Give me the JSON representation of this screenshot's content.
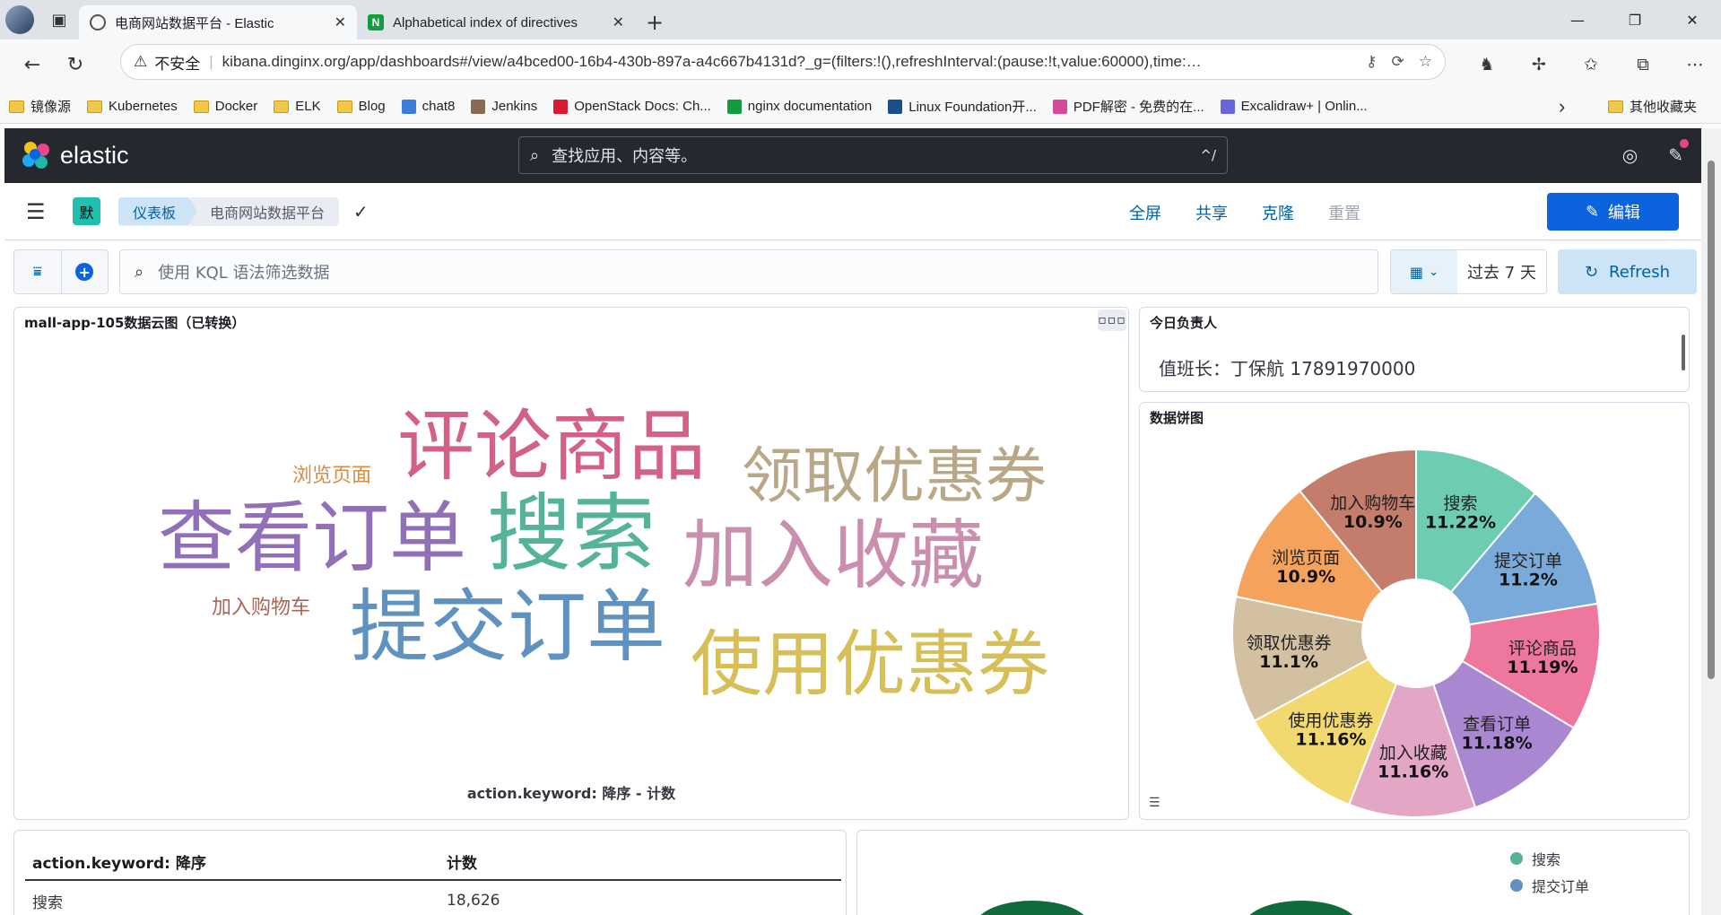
{
  "browser": {
    "tabs": [
      {
        "title": "电商网站数据平台 - Elastic",
        "active": true
      },
      {
        "title": "Alphabetical index of directives",
        "active": false
      }
    ],
    "address": {
      "security_label": "不安全",
      "url": "kibana.dinginx.org/app/dashboards#/view/a4bced00-16b4-430b-897a-a4c667b4131d?_g=(filters:!(),refreshInterval:(pause:!t,value:60000),time:…"
    },
    "bookmarks": [
      {
        "label": "镜像源",
        "icon": "folder-icon"
      },
      {
        "label": "Kubernetes",
        "icon": "folder-icon"
      },
      {
        "label": "Docker",
        "icon": "folder-icon"
      },
      {
        "label": "ELK",
        "icon": "folder-icon"
      },
      {
        "label": "Blog",
        "icon": "folder-icon"
      },
      {
        "label": "chat8",
        "icon": "chat-icon"
      },
      {
        "label": "Jenkins",
        "icon": "jenkins-icon"
      },
      {
        "label": "OpenStack Docs: Ch...",
        "icon": "openstack-icon"
      },
      {
        "label": "nginx documentation",
        "icon": "nginx-icon"
      },
      {
        "label": "Linux Foundation开...",
        "icon": "linux-foundation-icon"
      },
      {
        "label": "PDF解密 - 免费的在...",
        "icon": "pdf-icon"
      },
      {
        "label": "Excalidraw+ | Onlin...",
        "icon": "excalidraw-icon"
      }
    ],
    "other_bookmarks": "其他收藏夹"
  },
  "kibana": {
    "brand": "elastic",
    "search_placeholder": "查找应用、内容等。",
    "search_shortcut": "^/",
    "space_badge": "默",
    "breadcrumbs": [
      "仪表板",
      "电商网站数据平台"
    ],
    "actions": {
      "fullscreen": "全屏",
      "share": "共享",
      "clone": "克隆",
      "reset": "重置",
      "edit": "编辑"
    },
    "query_placeholder": "使用 KQL 语法筛选数据",
    "time_range": "过去 7 天",
    "refresh": "Refresh"
  },
  "panels": {
    "wordcloud": {
      "title": "mall-app-105数据云图（已转换）",
      "footer": "action.keyword: 降序 - 计数",
      "words": [
        {
          "text": "评论商品",
          "color": "#d36086"
        },
        {
          "text": "领取优惠券",
          "color": "#b9a888"
        },
        {
          "text": "浏览页面",
          "color": "#da8b45"
        },
        {
          "text": "查看订单",
          "color": "#9170b8"
        },
        {
          "text": "搜索",
          "color": "#54b399"
        },
        {
          "text": "加入收藏",
          "color": "#ca8eae"
        },
        {
          "text": "加入购物车",
          "color": "#aa6556"
        },
        {
          "text": "提交订单",
          "color": "#6092c0"
        },
        {
          "text": "使用优惠券",
          "color": "#d6bf57"
        }
      ]
    },
    "duty": {
      "title": "今日负责人",
      "text": "值班长：丁保航 17891970000"
    },
    "pie": {
      "title": "数据饼图"
    },
    "table": {
      "headers": [
        "action.keyword: 降序",
        "计数"
      ],
      "rows": [
        [
          "搜索",
          "18,626"
        ]
      ]
    },
    "legend_panel": {
      "items": [
        {
          "label": "搜索",
          "color": "#54b399"
        },
        {
          "label": "提交订单",
          "color": "#6092c0"
        }
      ]
    }
  },
  "chart_data": {
    "type": "pie",
    "title": "数据饼图",
    "donut": true,
    "slices": [
      {
        "label": "搜索",
        "value": 11.22,
        "display": "11.22%",
        "color": "#6dccb1"
      },
      {
        "label": "提交订单",
        "value": 11.2,
        "display": "11.2%",
        "color": "#79aad9"
      },
      {
        "label": "评论商品",
        "value": 11.19,
        "display": "11.19%",
        "color": "#ee789d"
      },
      {
        "label": "查看订单",
        "value": 11.18,
        "display": "11.18%",
        "color": "#a987d1"
      },
      {
        "label": "加入收藏",
        "value": 11.16,
        "display": "11.16%",
        "color": "#e4a6c7"
      },
      {
        "label": "使用优惠券",
        "value": 11.16,
        "display": "11.16%",
        "color": "#f1d86f"
      },
      {
        "label": "领取优惠券",
        "value": 11.1,
        "display": "11.1%",
        "color": "#d2c0a0"
      },
      {
        "label": "浏览页面",
        "value": 10.9,
        "display": "10.9%",
        "color": "#f5a35c"
      },
      {
        "label": "加入购物车",
        "value": 10.9,
        "display": "10.9%",
        "color": "#c47c6c"
      }
    ]
  }
}
